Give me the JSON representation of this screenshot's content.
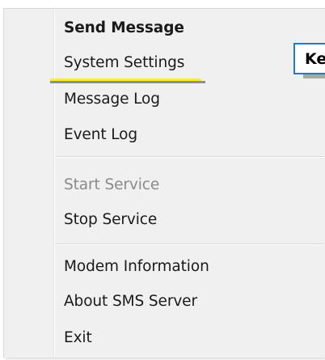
{
  "context_menu": {
    "items": [
      {
        "label": "Send Message",
        "bold": true,
        "disabled": false
      },
      {
        "label": "System Settings",
        "bold": false,
        "disabled": false
      },
      {
        "label": "Message Log",
        "bold": false,
        "disabled": false
      },
      {
        "label": "Event Log",
        "bold": false,
        "disabled": false
      },
      {
        "label": "Start Service",
        "bold": false,
        "disabled": true
      },
      {
        "label": "Stop Service",
        "bold": false,
        "disabled": false
      },
      {
        "label": "Modem Information",
        "bold": false,
        "disabled": false
      },
      {
        "label": "About SMS Server",
        "bold": false,
        "disabled": false
      },
      {
        "label": "Exit",
        "bold": false,
        "disabled": false
      }
    ]
  },
  "callout": {
    "text": "Ke"
  },
  "colors": {
    "menu_background": "#f0f0f0",
    "highlight_underline": "#ffef1a",
    "callout_border": "#1a7fc4",
    "disabled_text": "#8a8a8a"
  }
}
